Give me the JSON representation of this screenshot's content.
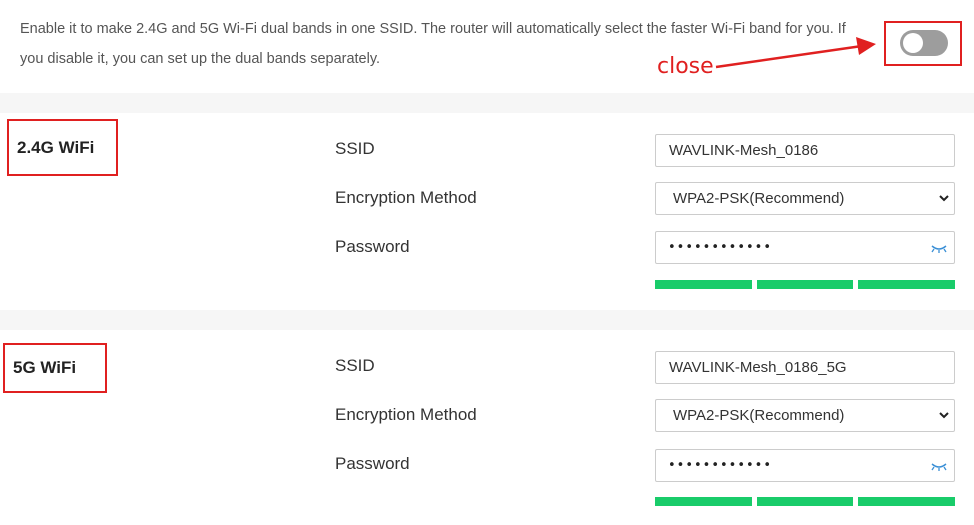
{
  "dual_band": {
    "description": "Enable it to make 2.4G and 5G Wi-Fi dual bands in one SSID. The router will automatically select the faster Wi-Fi band for you. If you disable it, you can set up the dual bands separately.",
    "enabled": false
  },
  "annotation": {
    "close_label": "close",
    "color": "#e02020"
  },
  "bands": [
    {
      "title": "2.4G WiFi",
      "ssid_label": "SSID",
      "ssid_value": "WAVLINK-Mesh_0186",
      "encryption_label": "Encryption Method",
      "encryption_value": "WPA2-PSK(Recommend)",
      "password_label": "Password",
      "password_mask": "••••••••••••",
      "password_strength": 1.0
    },
    {
      "title": "5G WiFi",
      "ssid_label": "SSID",
      "ssid_value": "WAVLINK-Mesh_0186_5G",
      "encryption_label": "Encryption Method",
      "encryption_value": "WPA2-PSK(Recommend)",
      "password_label": "Password",
      "password_mask": "••••••••••••",
      "password_strength": 1.0
    }
  ],
  "colors": {
    "strength": "#19cc6a",
    "toggle_off": "#9d9d9d",
    "eye": "#3a8fd6"
  },
  "icons": {
    "select_arrow": "chevron-down-icon",
    "password_toggle": "eye-closed-icon"
  }
}
